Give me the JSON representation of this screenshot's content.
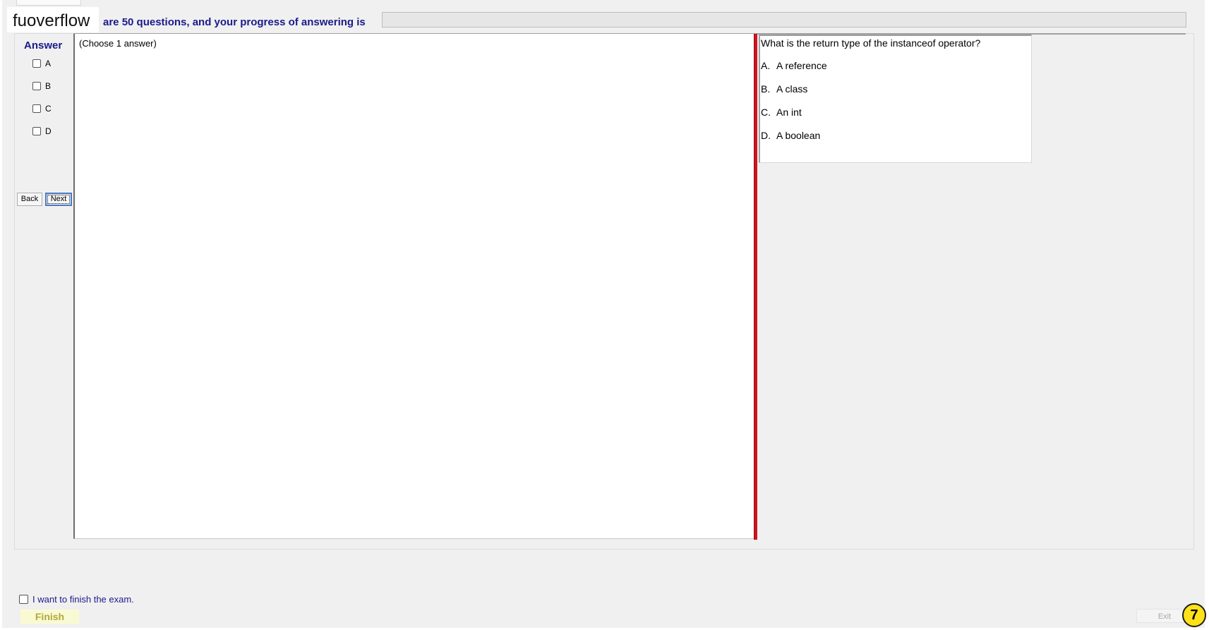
{
  "watermark": "fuoverflow",
  "header": {
    "progress_text": "are 50 questions, and your progress of answering is",
    "progress_value": 0
  },
  "answer_panel": {
    "title": "Answer",
    "options": [
      "A",
      "B",
      "C",
      "D"
    ],
    "back_label": "Back",
    "next_label": "Next"
  },
  "content": {
    "instruction": "(Choose 1 answer)"
  },
  "question": {
    "text": "What is the return type of the instanceof operator?",
    "options": [
      {
        "letter": "A.",
        "text": "A reference"
      },
      {
        "letter": "B.",
        "text": "A class"
      },
      {
        "letter": "C.",
        "text": "An int"
      },
      {
        "letter": "D.",
        "text": "A boolean"
      }
    ]
  },
  "footer": {
    "finish_check_label": "I want to finish the exam.",
    "finish_label": "Finish",
    "exit_label": "Exit",
    "badge": "7"
  },
  "colors": {
    "header_text": "#1a1a8c",
    "splitter": "#d0141e",
    "finish_bg": "#fafad2",
    "badge_bg": "#ffe11a"
  }
}
